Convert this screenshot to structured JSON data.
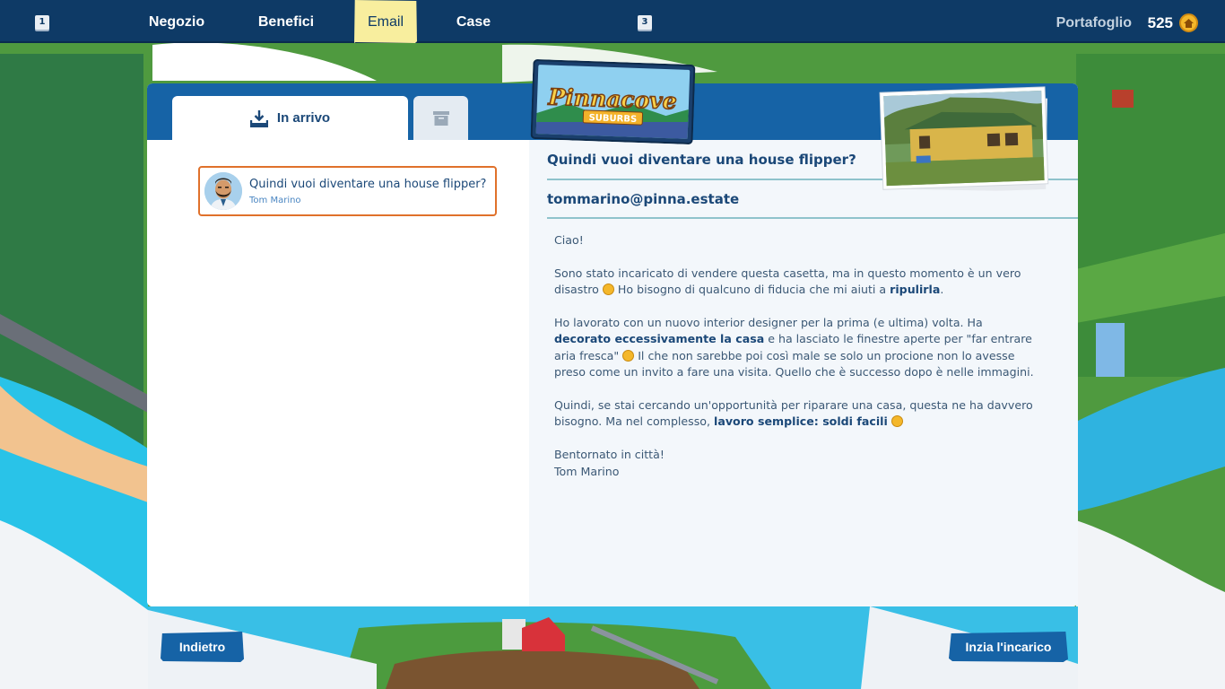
{
  "topbar": {
    "key_left": "1",
    "key_right": "3",
    "tabs": [
      {
        "label": "Negozio",
        "active": false
      },
      {
        "label": "Benefici",
        "active": false
      },
      {
        "label": "Email",
        "active": true
      },
      {
        "label": "Case",
        "active": false
      }
    ],
    "wallet_label": "Portafoglio",
    "wallet_value": "525",
    "coin_icon": "house-coin-icon"
  },
  "logo": {
    "line1": "Pinnacove",
    "line2": "SUBURBS"
  },
  "mailbox": {
    "inbox_tab": "In arrivo",
    "inbox_icon": "inbox-download-icon",
    "archive_icon": "archive-box-icon",
    "items": [
      {
        "subject": "Quindi vuoi diventare una house flipper?",
        "sender": "Tom Marino"
      }
    ]
  },
  "email": {
    "subject": "Quindi vuoi diventare una house flipper?",
    "from": "tommarino@pinna.estate",
    "greeting": "Ciao!",
    "p1_a": "Sono stato incaricato di vendere questa casetta, ma in questo momento è un vero disastro",
    "p1_b": " Ho bisogno di qualcuno di fiducia che mi aiuti a ",
    "p1_bold": "ripulirla",
    "p1_end": ".",
    "p2_a": "Ho lavorato con un nuovo interior designer per la prima (e ultima) volta. Ha ",
    "p2_bold": "decorato eccessivamente la casa",
    "p2_b": " e ha lasciato le finestre aperte per \"far entrare aria fresca\"",
    "p2_c": " Il che non sarebbe poi così male se solo un procione non lo avesse preso come un invito a fare una visita. Quello che è successo dopo è nelle immagini.",
    "p3_a": "Quindi, se stai cercando un'opportunità per riparare una casa, questa ne ha davvero bisogno. Ma nel complesso, ",
    "p3_bold": "lavoro semplice: soldi facili",
    "closing": "Bentornato in città!",
    "signature": "Tom Marino"
  },
  "buttons": {
    "back": "Indietro",
    "start": "Inzia l'incarico"
  },
  "colors": {
    "topbar": "#0e3a66",
    "panel_header": "#1663a6",
    "active_tab": "#f8ee9e",
    "selected_border": "#e0712b",
    "text_dark": "#1b4878"
  }
}
